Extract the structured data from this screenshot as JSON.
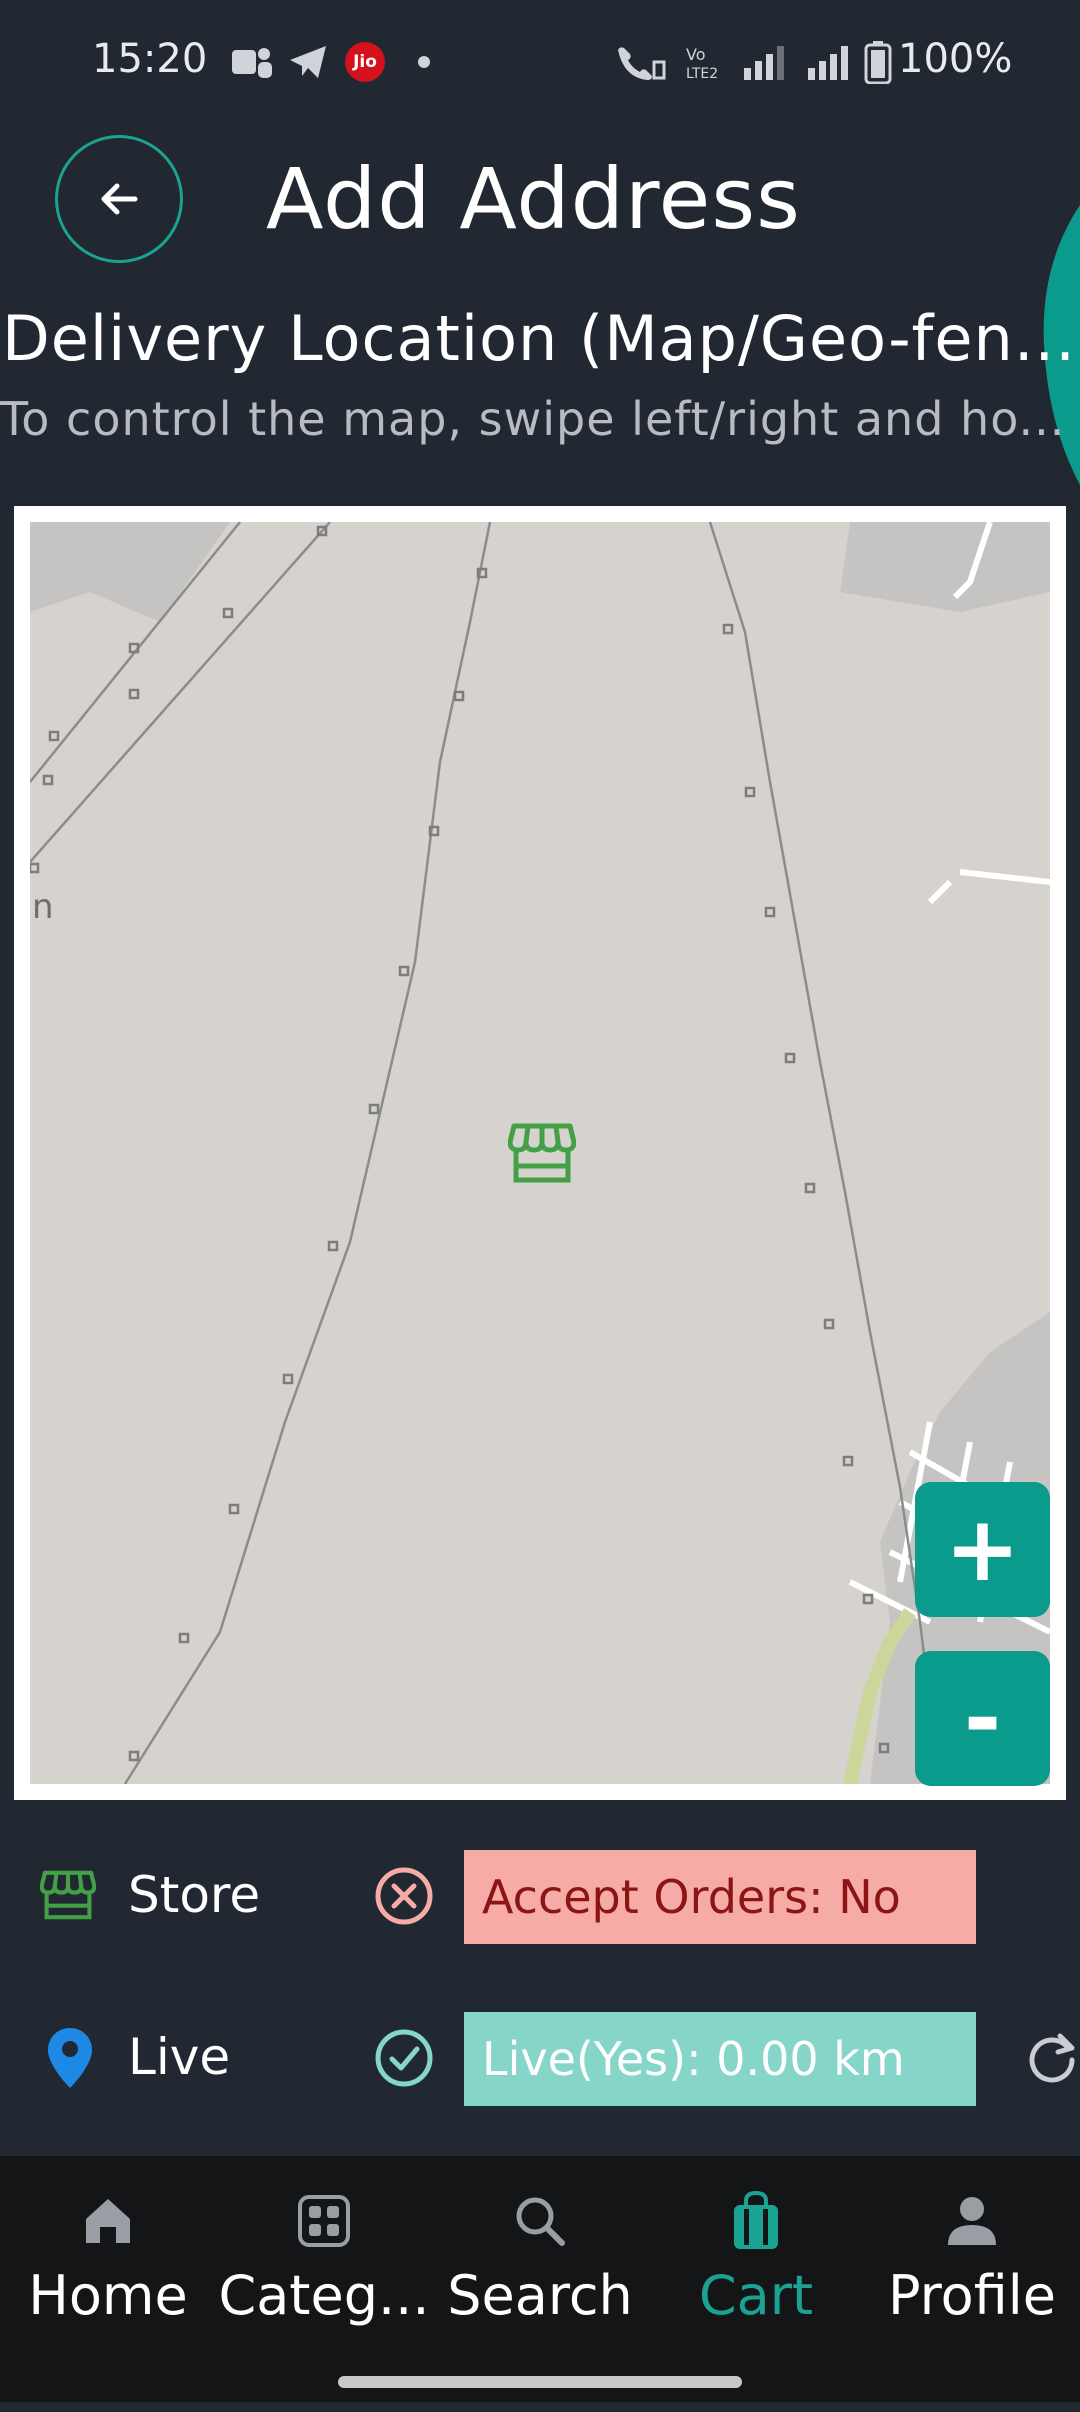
{
  "status_bar": {
    "time": "15:20",
    "battery": "100%",
    "carrier_badge": "Jio",
    "icons": [
      "teams-icon",
      "telegram-icon",
      "jio-icon",
      "dot-icon",
      "wifi-call-icon",
      "volte-icon",
      "signal-icon",
      "signal-icon",
      "battery-icon"
    ]
  },
  "header": {
    "title": "Add Address",
    "back_icon": "arrow-left-icon"
  },
  "section": {
    "title": "Delivery Location (Map/Geo-fen...",
    "hint": "To control the map, swipe left/right and ho..."
  },
  "map": {
    "place_label": "n",
    "marker_icon": "store-icon",
    "zoom_in_label": "+",
    "zoom_out_label": "-"
  },
  "legend": {
    "store": {
      "label": "Store",
      "icon": "store-icon",
      "status_icon": "x-circle-icon",
      "status_text": "Accept Orders: No"
    },
    "live": {
      "label": "Live",
      "icon": "location-pin-icon",
      "status_icon": "check-circle-icon",
      "status_text": "Live(Yes): 0.00 km",
      "action_icon": "refresh-icon"
    }
  },
  "bottom_nav": [
    {
      "label": "Home",
      "icon": "home-icon"
    },
    {
      "label": "Categ...",
      "icon": "grid-icon"
    },
    {
      "label": "Search",
      "icon": "search-icon"
    },
    {
      "label": "Cart",
      "icon": "shopping-bag-icon",
      "active": true
    },
    {
      "label": "Profile",
      "icon": "user-icon"
    }
  ],
  "colors": {
    "background": "#222831",
    "accent": "#0b9b8c",
    "store_green": "#43a047",
    "pin_blue": "#1e88e5",
    "reject_bg": "#f7aba6",
    "live_bg": "#85d6c8"
  }
}
